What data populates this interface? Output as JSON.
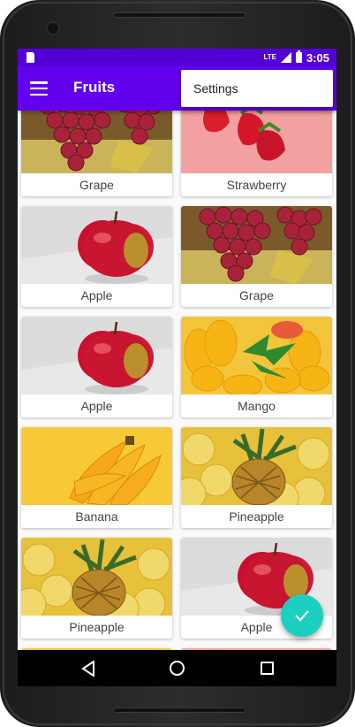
{
  "status_bar": {
    "network": "LTE",
    "time": "3:05"
  },
  "toolbar": {
    "title": "Fruits",
    "menu_icon": "hamburger-icon"
  },
  "overflow_menu": {
    "items": [
      {
        "label": "Settings"
      }
    ]
  },
  "fruit_grid": [
    {
      "name": "Grape",
      "image": "grape"
    },
    {
      "name": "Strawberry",
      "image": "strawberry"
    },
    {
      "name": "Apple",
      "image": "apple"
    },
    {
      "name": "Grape",
      "image": "grape"
    },
    {
      "name": "Apple",
      "image": "apple"
    },
    {
      "name": "Mango",
      "image": "mango"
    },
    {
      "name": "Banana",
      "image": "banana"
    },
    {
      "name": "Pineapple",
      "image": "pineapple"
    },
    {
      "name": "Pineapple",
      "image": "pineapple"
    },
    {
      "name": "Apple",
      "image": "apple"
    },
    {
      "name": "",
      "image": "banana"
    },
    {
      "name": "",
      "image": "strawberry"
    }
  ],
  "fab": {
    "icon": "check-icon",
    "color": "#1ccfc0"
  },
  "colors": {
    "primary": "#6200ee",
    "status_bar": "#5200d6",
    "accent": "#1ccfc0"
  },
  "nav_bar": {
    "icons": [
      "back-icon",
      "home-icon",
      "recent-apps-icon"
    ]
  }
}
